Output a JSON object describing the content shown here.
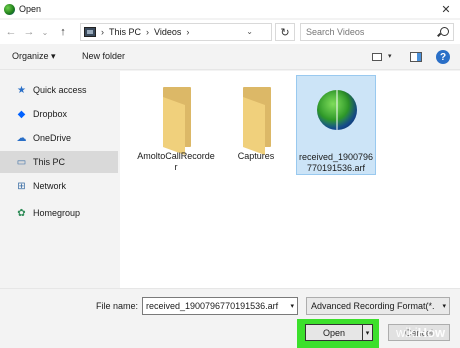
{
  "window": {
    "title": "Open",
    "close_glyph": "✕"
  },
  "address": {
    "back_glyph": "←",
    "forward_glyph": "→",
    "recent_glyph": "⌄",
    "up_glyph": "↑",
    "crumbs": [
      "This PC",
      "Videos"
    ],
    "separator": "›",
    "dropdown_glyph": "⌄",
    "refresh_glyph": "↻"
  },
  "search": {
    "placeholder": "Search Videos"
  },
  "toolbar": {
    "organize_label": "Organize ▾",
    "new_folder_label": "New folder",
    "view_dd_glyph": "▾",
    "help_glyph": "?"
  },
  "sidebar": {
    "items": [
      {
        "label": "Quick access",
        "icon": "star-icon",
        "glyph": "★",
        "color": "#2a6fc7"
      },
      {
        "label": "Dropbox",
        "icon": "dropbox-icon",
        "glyph": "◆",
        "color": "#0061fe"
      },
      {
        "label": "OneDrive",
        "icon": "cloud-icon",
        "glyph": "☁",
        "color": "#2a6fc7"
      },
      {
        "label": "This PC",
        "icon": "monitor-icon",
        "glyph": "▭",
        "color": "#3b6ea5"
      },
      {
        "label": "Network",
        "icon": "network-icon",
        "glyph": "⊞",
        "color": "#3b6ea5"
      },
      {
        "label": "Homegroup",
        "icon": "homegroup-icon",
        "glyph": "✿",
        "color": "#2e8b57"
      }
    ],
    "selected": "This PC"
  },
  "files": [
    {
      "name": "AmoltoCallRecorder",
      "type": "folder"
    },
    {
      "name": "Captures",
      "type": "folder"
    },
    {
      "name": "received_1900796770191536.arf",
      "display": "received_1900796770191536.arf",
      "type": "media",
      "selected": true
    }
  ],
  "footer": {
    "file_name_label": "File name:",
    "file_name_value": "received_1900796770191536.arf",
    "file_type_value": "Advanced Recording Format(*.",
    "dd_glyph": "▾",
    "open_label": "Open",
    "cancel_label": "Cancel"
  },
  "watermark": {
    "wiki": "wiki",
    "how": "How"
  },
  "colors": {
    "highlight": "#3ce02c",
    "selection": "#cce4f7"
  }
}
